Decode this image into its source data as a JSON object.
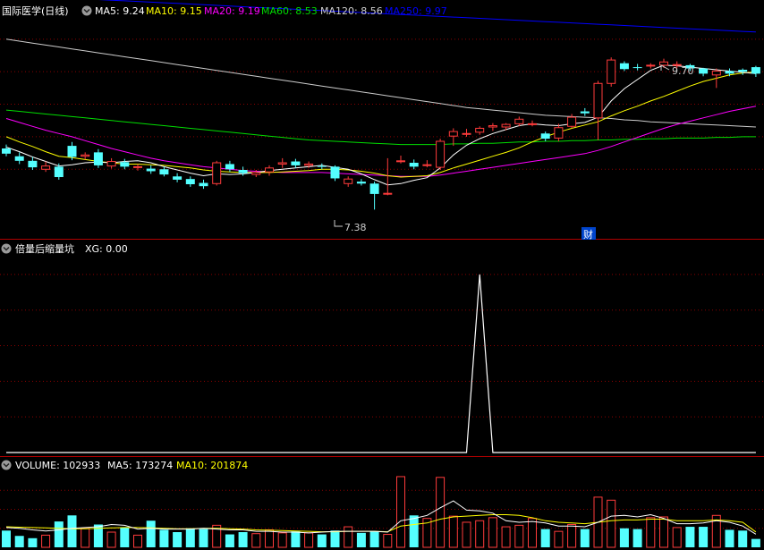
{
  "stock": {
    "name": "国际医学",
    "period": "(日线)"
  },
  "price_header": {
    "ma5": "MA5: 9.24",
    "ma10": "MA10: 9.15",
    "ma20": "MA20: 9.19",
    "ma60": "MA60: 8.53",
    "ma120": "MA120: 8.56",
    "ma250": "MA250: 9.97"
  },
  "annotations": {
    "high": "9.70",
    "low": "7.38",
    "fin_marker": "财"
  },
  "indicator": {
    "name": "倍量后缩量坑",
    "xg": "XG: 0.00"
  },
  "volume_header": {
    "volume": "VOLUME: 102933",
    "ma5": "MA5: 173274",
    "ma10": "MA10: 201874"
  },
  "colors": {
    "bg": "#000000",
    "up": "#ff3b3b",
    "down": "#54ffff",
    "grid": "#8b0000",
    "ma5": "#ffffff",
    "ma10": "#ffff00",
    "ma20": "#ff00ff",
    "ma60": "#00dd00",
    "ma120": "#cccccc",
    "ma250": "#0000ff",
    "xg": "#ffffff"
  },
  "chart_data": [
    {
      "type": "candlestick",
      "title": "国际医学(日线)",
      "ylim": [
        7.0,
        10.3
      ],
      "series": [
        {
          "name": "K",
          "values": [
            [
              8.32,
              8.24,
              8.38,
              8.2
            ],
            [
              8.2,
              8.13,
              8.26,
              8.08
            ],
            [
              8.13,
              8.03,
              8.19,
              7.99
            ],
            [
              8.0,
              8.05,
              8.12,
              7.96
            ],
            [
              8.04,
              7.88,
              8.09,
              7.84
            ],
            [
              8.36,
              8.19,
              8.42,
              8.14
            ],
            [
              8.2,
              8.22,
              8.26,
              8.15
            ],
            [
              8.26,
              8.06,
              8.31,
              8.02
            ],
            [
              8.05,
              8.12,
              8.17,
              8.01
            ],
            [
              8.11,
              8.04,
              8.16,
              8.0
            ],
            [
              8.04,
              8.04,
              8.08,
              7.98
            ],
            [
              8.01,
              7.97,
              8.06,
              7.93
            ],
            [
              8.0,
              7.92,
              8.04,
              7.89
            ],
            [
              7.89,
              7.84,
              7.94,
              7.8
            ],
            [
              7.85,
              7.77,
              7.89,
              7.73
            ],
            [
              7.79,
              7.74,
              7.84,
              7.7
            ],
            [
              7.78,
              8.1,
              8.13,
              7.75
            ],
            [
              8.08,
              8.0,
              8.13,
              7.96
            ],
            [
              7.99,
              7.94,
              8.04,
              7.9
            ],
            [
              7.92,
              7.95,
              7.99,
              7.88
            ],
            [
              7.96,
              8.02,
              8.06,
              7.9
            ],
            [
              8.08,
              8.1,
              8.17,
              8.02
            ],
            [
              8.12,
              8.06,
              8.16,
              8.02
            ],
            [
              8.06,
              8.08,
              8.12,
              8.02
            ],
            [
              8.05,
              8.04,
              8.09,
              8.0
            ],
            [
              8.04,
              7.86,
              8.06,
              7.82
            ],
            [
              7.78,
              7.85,
              7.89,
              7.73
            ],
            [
              7.81,
              7.78,
              7.85,
              7.75
            ],
            [
              7.78,
              7.62,
              7.81,
              7.38
            ],
            [
              7.62,
              7.63,
              8.17,
              7.6
            ],
            [
              8.13,
              8.13,
              8.21,
              8.09
            ],
            [
              8.1,
              8.04,
              8.15,
              8.0
            ],
            [
              8.07,
              8.07,
              8.14,
              8.03
            ],
            [
              8.03,
              8.43,
              8.47,
              7.99
            ],
            [
              8.51,
              8.58,
              8.63,
              8.36
            ],
            [
              8.55,
              8.55,
              8.62,
              8.5
            ],
            [
              8.57,
              8.63,
              8.66,
              8.53
            ],
            [
              8.65,
              8.67,
              8.71,
              8.59
            ],
            [
              8.65,
              8.69,
              8.71,
              8.6
            ],
            [
              8.7,
              8.77,
              8.81,
              8.66
            ],
            [
              8.7,
              8.7,
              8.75,
              8.66
            ],
            [
              8.55,
              8.47,
              8.58,
              8.43
            ],
            [
              8.48,
              8.64,
              8.7,
              8.43
            ],
            [
              8.66,
              8.8,
              8.85,
              8.63
            ],
            [
              8.89,
              8.86,
              8.94,
              8.82
            ],
            [
              8.79,
              9.32,
              9.36,
              8.45
            ],
            [
              9.32,
              9.68,
              9.72,
              9.27
            ],
            [
              9.63,
              9.54,
              9.66,
              9.51
            ],
            [
              9.57,
              9.56,
              9.62,
              9.52
            ],
            [
              9.6,
              9.6,
              9.63,
              9.55
            ],
            [
              9.6,
              9.65,
              9.7,
              9.56
            ],
            [
              9.6,
              9.61,
              9.66,
              9.55
            ],
            [
              9.6,
              9.55,
              9.62,
              9.51
            ],
            [
              9.55,
              9.47,
              9.56,
              9.43
            ],
            [
              9.45,
              9.51,
              9.55,
              9.25
            ],
            [
              9.51,
              9.47,
              9.55,
              9.43
            ],
            [
              9.53,
              9.5,
              9.55,
              9.45
            ],
            [
              9.57,
              9.47,
              9.59,
              9.42
            ]
          ]
        },
        {
          "name": "MA5",
          "values": [
            8.34,
            8.27,
            8.19,
            8.12,
            8.05,
            8.07,
            8.1,
            8.11,
            8.1,
            8.12,
            8.13,
            8.1,
            8.04,
            7.99,
            7.94,
            7.9,
            7.93,
            7.92,
            7.93,
            7.95,
            7.98,
            8.0,
            8.02,
            8.04,
            8.06,
            8.03,
            8.0,
            7.93,
            7.84,
            7.76,
            7.78,
            7.83,
            7.87,
            8.02,
            8.22,
            8.37,
            8.47,
            8.55,
            8.61,
            8.67,
            8.7,
            8.68,
            8.67,
            8.7,
            8.72,
            8.8,
            9.05,
            9.24,
            9.38,
            9.52,
            9.6,
            9.59,
            9.57,
            9.55,
            9.53,
            9.51,
            9.49,
            9.47
          ]
        },
        {
          "name": "MA10",
          "values": [
            8.5,
            8.42,
            8.35,
            8.27,
            8.2,
            8.18,
            8.15,
            8.12,
            8.1,
            8.08,
            8.08,
            8.07,
            8.06,
            8.04,
            8.02,
            7.99,
            7.97,
            7.96,
            7.95,
            7.95,
            7.95,
            7.96,
            7.97,
            7.98,
            8.0,
            8.0,
            7.99,
            7.97,
            7.94,
            7.9,
            7.88,
            7.89,
            7.9,
            7.95,
            8.02,
            8.08,
            8.14,
            8.2,
            8.26,
            8.33,
            8.42,
            8.5,
            8.57,
            8.63,
            8.68,
            8.73,
            8.82,
            8.9,
            8.97,
            9.05,
            9.12,
            9.2,
            9.28,
            9.35,
            9.4,
            9.45,
            9.48,
            9.5
          ]
        },
        {
          "name": "MA20",
          "values": [
            8.78,
            8.72,
            8.66,
            8.6,
            8.55,
            8.5,
            8.44,
            8.38,
            8.32,
            8.27,
            8.22,
            8.17,
            8.13,
            8.1,
            8.07,
            8.04,
            8.02,
            8.0,
            7.98,
            7.97,
            7.96,
            7.95,
            7.95,
            7.95,
            7.95,
            7.94,
            7.93,
            7.92,
            7.91,
            7.9,
            7.89,
            7.89,
            7.89,
            7.91,
            7.94,
            7.97,
            8.0,
            8.03,
            8.06,
            8.09,
            8.12,
            8.15,
            8.18,
            8.21,
            8.24,
            8.29,
            8.35,
            8.42,
            8.49,
            8.56,
            8.63,
            8.69,
            8.74,
            8.79,
            8.84,
            8.89,
            8.93,
            8.97
          ]
        },
        {
          "name": "MA60",
          "values": [
            8.91,
            8.89,
            8.87,
            8.85,
            8.83,
            8.81,
            8.79,
            8.77,
            8.75,
            8.73,
            8.71,
            8.69,
            8.67,
            8.65,
            8.63,
            8.61,
            8.59,
            8.57,
            8.55,
            8.53,
            8.51,
            8.49,
            8.47,
            8.45,
            8.44,
            8.43,
            8.42,
            8.41,
            8.4,
            8.39,
            8.38,
            8.38,
            8.38,
            8.38,
            8.39,
            8.39,
            8.4,
            8.4,
            8.41,
            8.42,
            8.42,
            8.43,
            8.43,
            8.44,
            8.44,
            8.45,
            8.45,
            8.46,
            8.46,
            8.47,
            8.47,
            8.48,
            8.48,
            8.48,
            8.49,
            8.49,
            8.5,
            8.5
          ]
        },
        {
          "name": "MA120",
          "values": [
            10.0,
            9.97,
            9.94,
            9.91,
            9.88,
            9.85,
            9.82,
            9.79,
            9.76,
            9.73,
            9.7,
            9.67,
            9.64,
            9.61,
            9.58,
            9.55,
            9.52,
            9.49,
            9.46,
            9.43,
            9.4,
            9.37,
            9.34,
            9.31,
            9.28,
            9.25,
            9.22,
            9.19,
            9.16,
            9.13,
            9.1,
            9.07,
            9.04,
            9.01,
            8.98,
            8.95,
            8.93,
            8.91,
            8.89,
            8.87,
            8.85,
            8.83,
            8.82,
            8.81,
            8.8,
            8.79,
            8.78,
            8.76,
            8.75,
            8.73,
            8.72,
            8.71,
            8.7,
            8.69,
            8.68,
            8.67,
            8.66,
            8.65
          ]
        },
        {
          "name": "MA250",
          "values": [
            10.68,
            10.67,
            10.66,
            10.65,
            10.64,
            10.63,
            10.62,
            10.61,
            10.6,
            10.59,
            10.58,
            10.57,
            10.56,
            10.55,
            10.54,
            10.53,
            10.52,
            10.51,
            10.5,
            10.49,
            10.48,
            10.47,
            10.46,
            10.45,
            10.44,
            10.43,
            10.42,
            10.41,
            10.4,
            10.39,
            10.38,
            10.37,
            10.36,
            10.35,
            10.34,
            10.33,
            10.32,
            10.31,
            10.3,
            10.29,
            10.28,
            10.27,
            10.26,
            10.25,
            10.24,
            10.23,
            10.22,
            10.21,
            10.2,
            10.19,
            10.18,
            10.17,
            10.16,
            10.15,
            10.14,
            10.13,
            10.12,
            10.11
          ]
        }
      ]
    },
    {
      "type": "line",
      "title": "倍量后缩量坑",
      "ylim": [
        0,
        1.1
      ],
      "series": [
        {
          "name": "XG",
          "values": [
            0,
            0,
            0,
            0,
            0,
            0,
            0,
            0,
            0,
            0,
            0,
            0,
            0,
            0,
            0,
            0,
            0,
            0,
            0,
            0,
            0,
            0,
            0,
            0,
            0,
            0,
            0,
            0,
            0,
            0,
            0,
            0,
            0,
            0,
            0,
            0,
            1,
            0,
            0,
            0,
            0,
            0,
            0,
            0,
            0,
            0,
            0,
            0,
            0,
            0,
            0,
            0,
            0,
            0,
            0,
            0,
            0,
            0
          ]
        }
      ]
    },
    {
      "type": "bar",
      "title": "VOLUME",
      "ylim": [
        0,
        1000000
      ],
      "series": [
        {
          "name": "VOLUME",
          "values": [
            220000,
            150000,
            120000,
            160000,
            340000,
            420000,
            250000,
            300000,
            200000,
            260000,
            160000,
            350000,
            230000,
            200000,
            250000,
            240000,
            290000,
            170000,
            200000,
            180000,
            230000,
            190000,
            210000,
            190000,
            170000,
            220000,
            270000,
            190000,
            210000,
            170000,
            930000,
            420000,
            380000,
            920000,
            410000,
            330000,
            350000,
            390000,
            270000,
            290000,
            380000,
            240000,
            210000,
            300000,
            240000,
            660000,
            620000,
            250000,
            240000,
            390000,
            400000,
            260000,
            270000,
            270000,
            420000,
            230000,
            220000,
            110000
          ]
        },
        {
          "name": "MA5",
          "values": [
            260000,
            250000,
            230000,
            215000,
            230000,
            250000,
            260000,
            270000,
            300000,
            290000,
            240000,
            250000,
            240000,
            240000,
            240000,
            250000,
            240000,
            230000,
            230000,
            210000,
            210000,
            200000,
            200000,
            190000,
            200000,
            210000,
            210000,
            210000,
            210000,
            200000,
            350000,
            380000,
            420000,
            520000,
            610000,
            490000,
            480000,
            450000,
            350000,
            330000,
            340000,
            320000,
            280000,
            280000,
            270000,
            330000,
            410000,
            420000,
            400000,
            430000,
            380000,
            310000,
            310000,
            320000,
            350000,
            330000,
            280000,
            173274
          ]
        },
        {
          "name": "MA10",
          "values": [
            270000,
            265000,
            260000,
            255000,
            250000,
            245000,
            245000,
            250000,
            255000,
            260000,
            260000,
            255000,
            250000,
            245000,
            245000,
            250000,
            250000,
            245000,
            240000,
            230000,
            225000,
            220000,
            215000,
            210000,
            205000,
            205000,
            210000,
            210000,
            210000,
            205000,
            280000,
            300000,
            320000,
            370000,
            400000,
            410000,
            420000,
            430000,
            430000,
            420000,
            390000,
            350000,
            330000,
            320000,
            310000,
            330000,
            350000,
            360000,
            360000,
            370000,
            370000,
            350000,
            350000,
            350000,
            360000,
            350000,
            330000,
            201874
          ]
        }
      ]
    }
  ]
}
